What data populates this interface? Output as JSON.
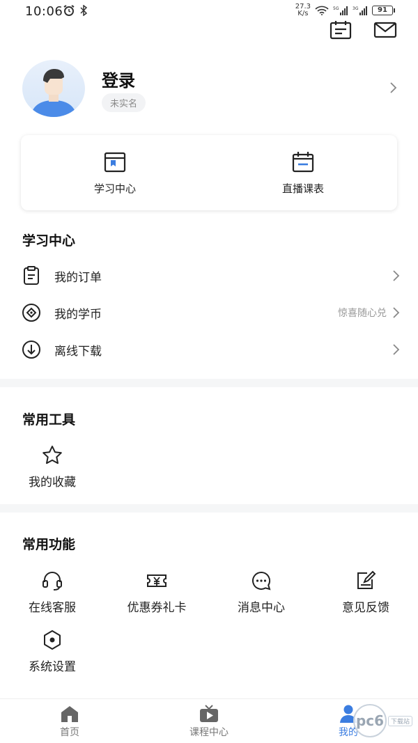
{
  "status_bar": {
    "time": "10:06",
    "speed_value": "27.3",
    "speed_unit": "K/s",
    "battery": "91"
  },
  "top_actions": {
    "calendar_icon": "calendar-icon",
    "mail_icon": "mail-icon"
  },
  "profile": {
    "title": "登录",
    "tag": "未实名"
  },
  "quick_card": [
    {
      "label": "学习中心",
      "icon": "study-center-icon"
    },
    {
      "label": "直播课表",
      "icon": "live-schedule-icon"
    }
  ],
  "study_section": {
    "title": "学习中心",
    "items": [
      {
        "label": "我的订单",
        "hint": "",
        "icon": "order-icon"
      },
      {
        "label": "我的学币",
        "hint": "惊喜随心兑",
        "icon": "coin-icon"
      },
      {
        "label": "离线下载",
        "hint": "",
        "icon": "download-icon"
      }
    ]
  },
  "tools_section": {
    "title": "常用工具",
    "items": [
      {
        "label": "我的收藏",
        "icon": "star-icon"
      }
    ]
  },
  "functions_section": {
    "title": "常用功能",
    "items": [
      {
        "label": "在线客服",
        "icon": "headset-icon"
      },
      {
        "label": "优惠券礼卡",
        "icon": "coupon-icon"
      },
      {
        "label": "消息中心",
        "icon": "message-icon"
      },
      {
        "label": "意见反馈",
        "icon": "feedback-icon"
      },
      {
        "label": "系统设置",
        "icon": "settings-icon"
      }
    ]
  },
  "bottom_nav": [
    {
      "label": "首页",
      "icon": "home-icon"
    },
    {
      "label": "课程中心",
      "icon": "course-icon"
    },
    {
      "label": "我的",
      "icon": "profile-icon",
      "active": true
    }
  ],
  "watermark": {
    "text": "pc6",
    "tag": "下载站"
  },
  "colors": {
    "accent": "#3b7de0",
    "text": "#222222",
    "muted": "#999999",
    "band": "#f5f6f7"
  }
}
